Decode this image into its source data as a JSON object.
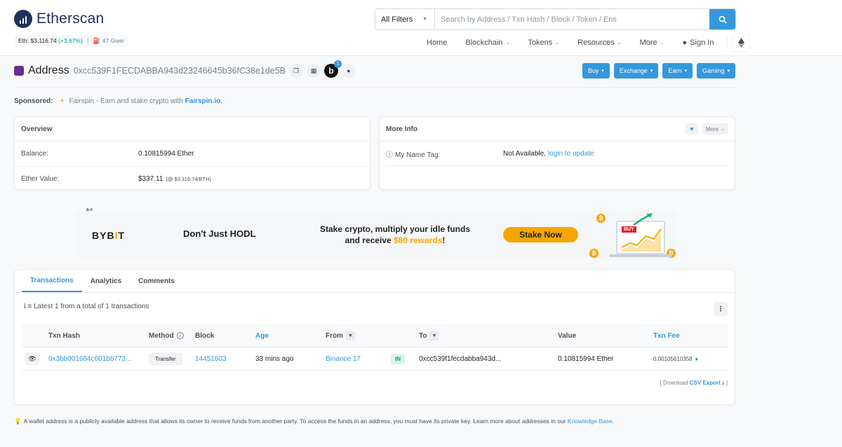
{
  "header": {
    "brand": "Etherscan",
    "eth_price_label": "Eth:",
    "eth_price": "$3,116.74",
    "eth_change": "(+3.67%)",
    "gas": "47 Gwei",
    "search_filter": "All Filters",
    "search_placeholder": "Search by Address / Txn Hash / Block / Token / Ens",
    "nav": {
      "home": "Home",
      "blockchain": "Blockchain",
      "tokens": "Tokens",
      "resources": "Resources",
      "more": "More",
      "signin": "Sign In"
    }
  },
  "address": {
    "label": "Address",
    "hash": "0xcc539F1FECDABBA943d23246645b36fC38e1de5B",
    "badge_count": "1",
    "b_letter": "b"
  },
  "actions": {
    "buy": "Buy",
    "exchange": "Exchange",
    "earn": "Earn",
    "gaming": "Gaming"
  },
  "sponsored": {
    "label": "Sponsored:",
    "name": "Fairspin",
    "text": " - Earn and stake crypto with ",
    "link": "Fairspin.io."
  },
  "overview": {
    "title": "Overview",
    "balance_label": "Balance:",
    "balance_value": "0.10815994 Ether",
    "value_label": "Ether Value:",
    "value_amount": "$337.11",
    "value_rate": "(@ $3,116.74/ETH)"
  },
  "more_info": {
    "title": "More Info",
    "more_btn": "More",
    "name_tag_label": "My Name Tag:",
    "name_tag_value": "Not Available,",
    "name_tag_link": "login to update"
  },
  "ad": {
    "tag": "Ad",
    "brand_a": "BYB",
    "brand_b": "I",
    "brand_c": "T",
    "headline": "Don't Just HODL",
    "line1": "Stake crypto, multiply your idle funds",
    "line2_a": "and receive ",
    "line2_hl": "$80 rewards",
    "line2_b": "!",
    "cta": "Stake Now",
    "buy_tag": "BUY"
  },
  "tabs": {
    "transactions": "Transactions",
    "analytics": "Analytics",
    "comments": "Comments"
  },
  "txns": {
    "summary": "Latest 1 from a total of 1 transactions",
    "headers": {
      "hash": "Txn Hash",
      "method": "Method",
      "block": "Block",
      "age": "Age",
      "from": "From",
      "to": "To",
      "value": "Value",
      "fee": "Txn Fee"
    },
    "rows": [
      {
        "hash": "0x3bb001684c601bb773...",
        "method": "Transfer",
        "block": "14451603",
        "age": "33 mins ago",
        "from": "Binance 17",
        "direction": "IN",
        "to": "0xcc539f1fecdabba943d...",
        "value": "0.10815994 Ether",
        "fee": "0.00105610358"
      }
    ],
    "csv_prefix": "[ Download ",
    "csv_link": "CSV Export",
    "csv_suffix": " ]"
  },
  "footer": {
    "note": "A wallet address is a publicly available address that allows its owner to receive funds from another party. To access the funds in an address, you must have its private key. Learn more about addresses in our ",
    "link": "Knowledge Base",
    "end": "."
  },
  "colors": {
    "accent": "#3498db",
    "brand_dark": "#21325b",
    "positive": "#00a186",
    "bybit_orange": "#f7a600"
  }
}
